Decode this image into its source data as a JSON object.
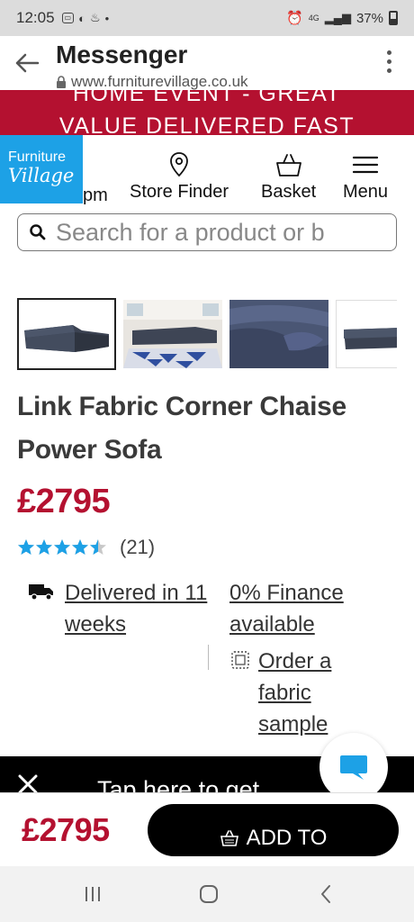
{
  "status_bar": {
    "time": "12:05",
    "signal_label": "4G",
    "battery": "37%"
  },
  "browser": {
    "title": "Messenger",
    "url": "www.furniturevillage.co.uk"
  },
  "promo": {
    "line1": "HOME EVENT - GREAT",
    "line2": "VALUE DELIVERED FAST"
  },
  "nav": {
    "logo_line1": "Furniture",
    "logo_line2": "Village",
    "partial_label": "pm",
    "items": [
      {
        "label": "Store Finder",
        "icon": "location-pin-icon"
      },
      {
        "label": "Basket",
        "icon": "basket-icon"
      },
      {
        "label": "Menu",
        "icon": "hamburger-icon"
      }
    ]
  },
  "search": {
    "placeholder": "Search for a product or b"
  },
  "product": {
    "title": "Link Fabric Corner Chaise Power Sofa",
    "price": "£2795",
    "rating": 4.5,
    "review_count": "(21)"
  },
  "features": {
    "delivery": "Delivered in 11 weeks",
    "finance": "0% Finance available",
    "sample": "Order a fabric sample"
  },
  "tap_bar": {
    "text": "Tap here to get"
  },
  "sticky": {
    "price": "£2795",
    "button_label": "ADD TO"
  },
  "colors": {
    "brand_red": "#b41130",
    "logo_blue": "#1da1e6",
    "star_blue": "#1da1e6"
  }
}
